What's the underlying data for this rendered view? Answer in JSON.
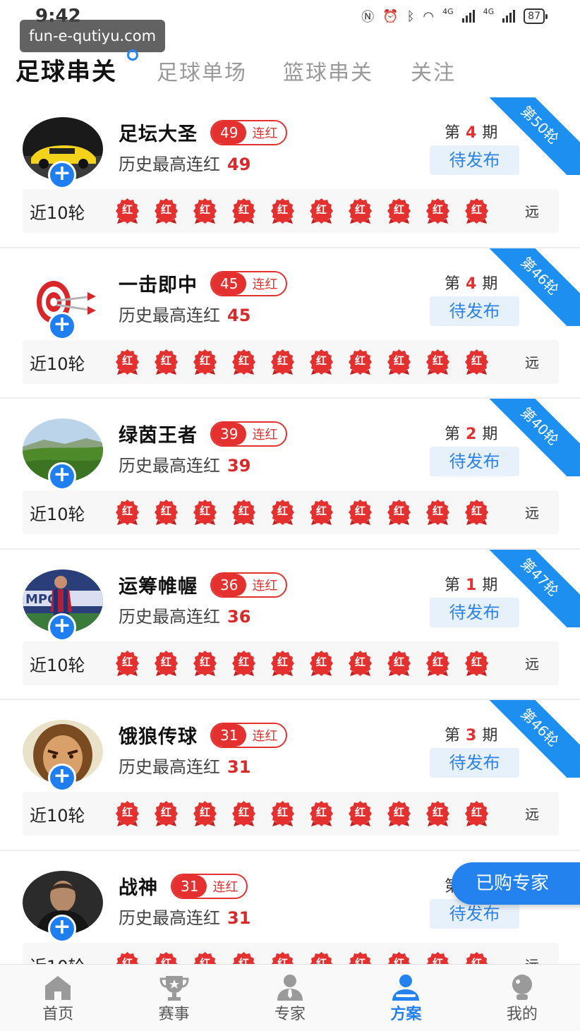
{
  "status_bar": {
    "time": "9:42",
    "battery": "87",
    "net_a": "4G",
    "net_b": "4G"
  },
  "watermark": "fun-e-qutiyu.com",
  "top_tabs": [
    {
      "label": "足球串关",
      "active": true
    },
    {
      "label": "足球单场",
      "active": false
    },
    {
      "label": "篮球串关",
      "active": false
    },
    {
      "label": "关注",
      "active": false
    }
  ],
  "labels": {
    "streak_suffix": "连红",
    "history_prefix": "历史最高连红",
    "issue_prefix": "第",
    "issue_suffix": "期",
    "pending": "待发布",
    "recent_rounds": "近10轮",
    "far": "远",
    "result_red": "红"
  },
  "experts": [
    {
      "name": "足坛大圣",
      "streak": "49",
      "history_max": "49",
      "issue": "4",
      "round_ribbon": "第50轮",
      "avatar": "car"
    },
    {
      "name": "一击即中",
      "streak": "45",
      "history_max": "45",
      "issue": "4",
      "round_ribbon": "第46轮",
      "avatar": "target"
    },
    {
      "name": "绿茵王者",
      "streak": "39",
      "history_max": "39",
      "issue": "2",
      "round_ribbon": "第40轮",
      "avatar": "landscape"
    },
    {
      "name": "运筹帷幄",
      "streak": "36",
      "history_max": "36",
      "issue": "1",
      "round_ribbon": "第47轮",
      "avatar": "player"
    },
    {
      "name": "饿狼传球",
      "streak": "31",
      "history_max": "31",
      "issue": "3",
      "round_ribbon": "第46轮",
      "avatar": "cartoon"
    },
    {
      "name": "战神",
      "streak": "31",
      "history_max": "31",
      "issue": "",
      "round_ribbon": "",
      "avatar": "man"
    }
  ],
  "float_button": "已购专家",
  "bottom_nav": [
    {
      "label": "首页",
      "icon": "home-icon",
      "active": false
    },
    {
      "label": "赛事",
      "icon": "trophy-icon",
      "active": false
    },
    {
      "label": "专家",
      "icon": "expert-icon",
      "active": false
    },
    {
      "label": "方案",
      "icon": "plan-icon",
      "active": true
    },
    {
      "label": "我的",
      "icon": "profile-icon",
      "active": false
    }
  ],
  "colors": {
    "accent_blue": "#2382ee",
    "streak_red": "#e53030",
    "ribbon_blue": "#1c8ff0"
  }
}
